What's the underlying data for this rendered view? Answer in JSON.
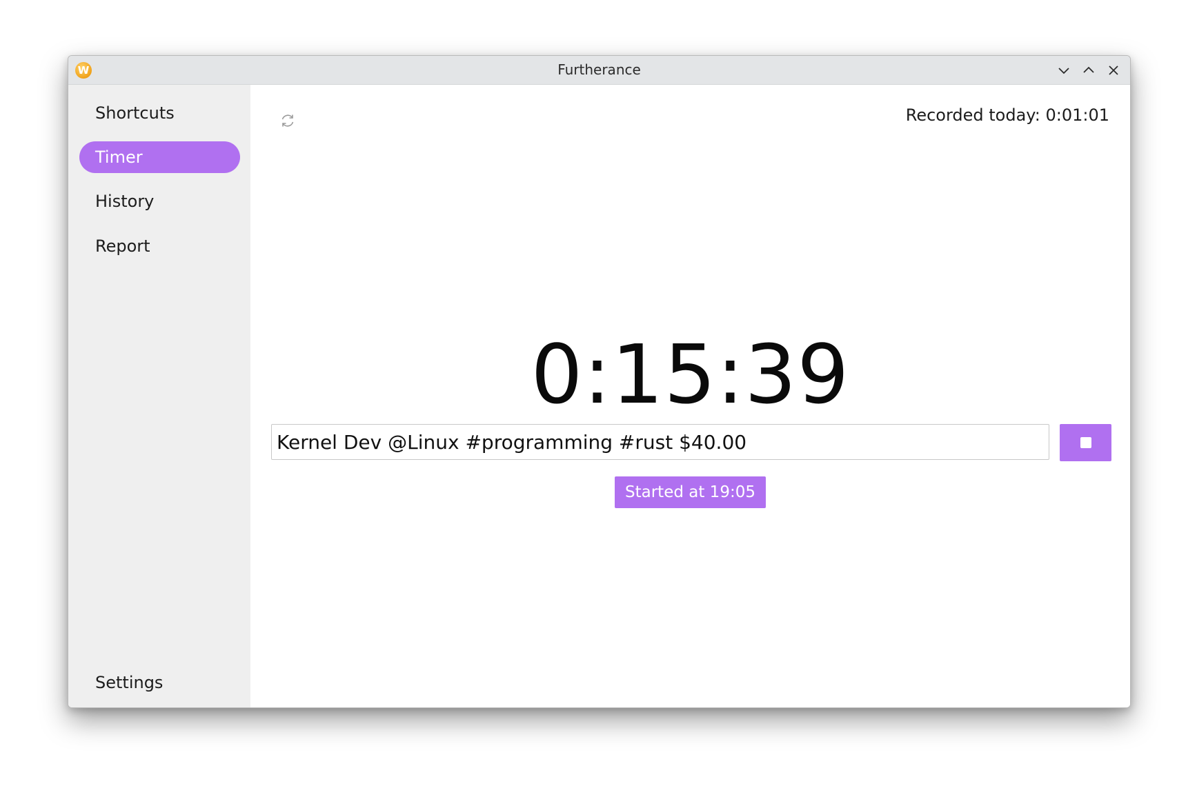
{
  "window": {
    "title": "Furtherance",
    "logo_letter": "W"
  },
  "sidebar": {
    "items": [
      {
        "label": "Shortcuts",
        "active": false
      },
      {
        "label": "Timer",
        "active": true
      },
      {
        "label": "History",
        "active": false
      },
      {
        "label": "Report",
        "active": false
      }
    ],
    "settings_label": "Settings"
  },
  "main": {
    "recorded_today": "Recorded today: 0:01:01",
    "timer": "0:15:39",
    "task_input_value": "Kernel Dev @Linux #programming #rust $40.00",
    "started_at": "Started at 19:05"
  },
  "icons": {
    "refresh": "refresh-icon",
    "stop": "stop-icon",
    "minimize": "chevron-down-icon",
    "maximize": "chevron-up-icon",
    "close": "close-icon"
  },
  "colors": {
    "accent": "#b070f0",
    "sidebar_bg": "#efefef",
    "titlebar_bg": "#e3e5e7"
  }
}
